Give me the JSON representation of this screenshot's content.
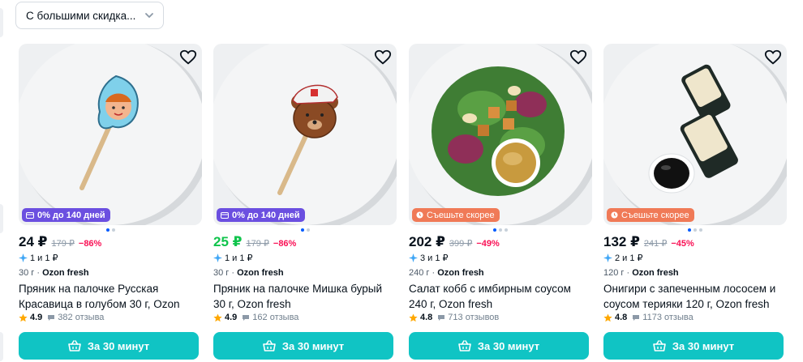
{
  "sort": {
    "label": "С большими скидка..."
  },
  "products": [
    {
      "badge": {
        "text": "0% до 140 дней",
        "style": "violet",
        "icon": "installment-card-icon"
      },
      "dots_active": 0,
      "price": "24 ₽",
      "price_color": "#10c44c",
      "old_price": "179 ₽",
      "discount": "−86%",
      "installment": "1 и 1 ₽",
      "weight": "30 г",
      "seller": "Ozon fresh",
      "title": "Пряник на палочке Русская Красавица в голубом 30 г, Ozon fresh",
      "rating": "4.9",
      "reviews": "382 отзыва",
      "button": "За 30 минут"
    },
    {
      "badge": {
        "text": "0% до 140 дней",
        "style": "violet",
        "icon": "installment-card-icon"
      },
      "dots_active": 0,
      "price": "25 ₽",
      "price_color": "#10c44c",
      "old_price": "179 ₽",
      "discount": "−86%",
      "installment": "1 и 1 ₽",
      "weight": "30 г",
      "seller": "Ozon fresh",
      "title": "Пряник на палочке Мишка бурый 30 г, Ozon fresh",
      "rating": "4.9",
      "reviews": "162 отзыва",
      "button": "За 30 минут"
    },
    {
      "badge": {
        "text": "Съешьте скорее",
        "style": "orange",
        "icon": "clock-icon"
      },
      "dots_active": 0,
      "price": "202 ₽",
      "price_color": "#07111b",
      "old_price": "399 ₽",
      "discount": "−49%",
      "installment": "3 и 1 ₽",
      "weight": "240 г",
      "seller": "Ozon fresh",
      "title": "Салат кобб с имбирным соусом 240 г, Ozon fresh",
      "rating": "4.8",
      "reviews": "713 отзывов",
      "button": "За 30 минут"
    },
    {
      "badge": {
        "text": "Съешьте скорее",
        "style": "orange",
        "icon": "clock-icon"
      },
      "dots_active": 0,
      "price": "132 ₽",
      "price_color": "#07111b",
      "old_price": "241 ₽",
      "discount": "−45%",
      "installment": "2 и 1 ₽",
      "weight": "120 г",
      "seller": "Ozon fresh",
      "title": "Онигири с запеченным лососем и соусом терияки 120 г, Ozon fresh",
      "rating": "4.8",
      "reviews": "1173 отзыва",
      "button": "За 30 минут"
    }
  ]
}
